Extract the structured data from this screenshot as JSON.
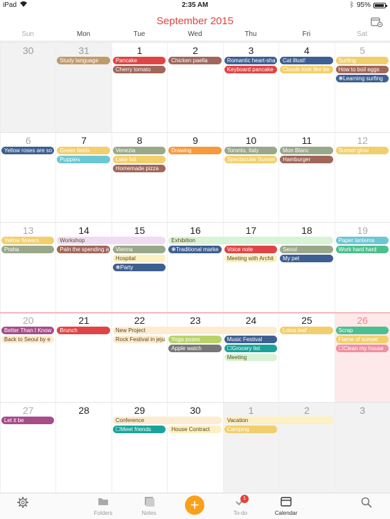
{
  "status": {
    "device": "iPad",
    "time": "2:35 AM",
    "battery": "95%",
    "battery_level": 0.95
  },
  "header": {
    "title": "September 2015"
  },
  "weekdays": [
    "Sun",
    "Mon",
    "Tue",
    "Wed",
    "Thu",
    "Fri",
    "Sat"
  ],
  "weeks": [
    {
      "days": [
        "30",
        "31",
        "1",
        "2",
        "3",
        "4",
        "5"
      ]
    },
    {
      "days": [
        "6",
        "7",
        "8",
        "9",
        "10",
        "11",
        "12"
      ]
    },
    {
      "days": [
        "13",
        "14",
        "15",
        "16",
        "17",
        "18",
        "19"
      ]
    },
    {
      "days": [
        "20",
        "21",
        "22",
        "23",
        "24",
        "25",
        "26"
      ]
    },
    {
      "days": [
        "27",
        "28",
        "29",
        "30",
        "1",
        "2",
        "3"
      ]
    }
  ],
  "events": [
    {
      "week": 0,
      "col": 1,
      "span": 1,
      "lane": 0,
      "label": "Study language",
      "color": "#c19a6b"
    },
    {
      "week": 0,
      "col": 2,
      "span": 1,
      "lane": 0,
      "label": "Pancake",
      "color": "#e04545"
    },
    {
      "week": 0,
      "col": 2,
      "span": 1,
      "lane": 1,
      "label": "Cherry tomato",
      "color": "#a0675a"
    },
    {
      "week": 0,
      "col": 3,
      "span": 1,
      "lane": 0,
      "label": "Chicken paella",
      "color": "#a0675a"
    },
    {
      "week": 0,
      "col": 4,
      "span": 1,
      "lane": 0,
      "label": "Romantic heart-sha",
      "color": "#3e5f91"
    },
    {
      "week": 0,
      "col": 4,
      "span": 1,
      "lane": 1,
      "label": "Keyboard pancake",
      "color": "#e04545"
    },
    {
      "week": 0,
      "col": 5,
      "span": 1,
      "lane": 0,
      "label": "Cat illust!",
      "color": "#3e5f91"
    },
    {
      "week": 0,
      "col": 5,
      "span": 1,
      "lane": 1,
      "label": "Clouds look like be",
      "color": "#f2cf6c"
    },
    {
      "week": 0,
      "col": 6,
      "span": 1,
      "lane": 0,
      "label": "Surfing",
      "color": "#f2cf6c"
    },
    {
      "week": 0,
      "col": 6,
      "span": 1,
      "lane": 1,
      "label": "How to boil eggs",
      "color": "#a0675a"
    },
    {
      "week": 0,
      "col": 6,
      "span": 1,
      "lane": 2,
      "label": "Learning surfing",
      "color": "#3e5f91",
      "prefix": "❋"
    },
    {
      "week": 1,
      "col": 0,
      "span": 1,
      "lane": 0,
      "label": "Yellow roses are so",
      "color": "#3e5f91"
    },
    {
      "week": 1,
      "col": 1,
      "span": 1,
      "lane": 0,
      "label": "Green fields",
      "color": "#f2cf6c"
    },
    {
      "week": 1,
      "col": 1,
      "span": 1,
      "lane": 1,
      "label": "Puppies",
      "color": "#6cc7d4"
    },
    {
      "week": 1,
      "col": 2,
      "span": 1,
      "lane": 0,
      "label": "Venezia",
      "color": "#9aa88a"
    },
    {
      "week": 1,
      "col": 2,
      "span": 1,
      "lane": 1,
      "label": "Lake fall",
      "color": "#f2cf6c"
    },
    {
      "week": 1,
      "col": 2,
      "span": 1,
      "lane": 2,
      "label": "Homemade pizza",
      "color": "#a0675a"
    },
    {
      "week": 1,
      "col": 3,
      "span": 1,
      "lane": 0,
      "label": "Drawing",
      "color": "#f59a3d"
    },
    {
      "week": 1,
      "col": 4,
      "span": 1,
      "lane": 0,
      "label": "Toronto, Italy",
      "color": "#9aa88a"
    },
    {
      "week": 1,
      "col": 4,
      "span": 1,
      "lane": 1,
      "label": "Spectacular Sunset",
      "color": "#f2cf6c"
    },
    {
      "week": 1,
      "col": 5,
      "span": 1,
      "lane": 0,
      "label": "Mon Blanc",
      "color": "#9aa88a"
    },
    {
      "week": 1,
      "col": 5,
      "span": 1,
      "lane": 1,
      "label": "Hamburger",
      "color": "#a0675a"
    },
    {
      "week": 1,
      "col": 6,
      "span": 1,
      "lane": 0,
      "label": "Sunset glow",
      "color": "#f2cf6c"
    },
    {
      "week": 2,
      "col": 0,
      "span": 1,
      "lane": 0,
      "label": "Yellow flowers",
      "color": "#f2cf6c"
    },
    {
      "week": 2,
      "col": 0,
      "span": 1,
      "lane": 1,
      "label": "Praha",
      "color": "#9aa88a"
    },
    {
      "week": 2,
      "col": 1,
      "span": 2,
      "lane": 0,
      "label": "Workshop",
      "color": "#efdcf3",
      "dark": true
    },
    {
      "week": 2,
      "col": 1,
      "span": 1,
      "lane": 1,
      "label": "Paln the spending a",
      "color": "#a0675a"
    },
    {
      "week": 2,
      "col": 2,
      "span": 1,
      "lane": 1,
      "label": "Vienna",
      "color": "#9aa88a"
    },
    {
      "week": 2,
      "col": 2,
      "span": 1,
      "lane": 2,
      "label": "Hospital",
      "color": "#fdf0c2",
      "dark": true
    },
    {
      "week": 2,
      "col": 2,
      "span": 1,
      "lane": 3,
      "label": "Party",
      "color": "#3e5f91",
      "prefix": "❋"
    },
    {
      "week": 2,
      "col": 3,
      "span": 3,
      "lane": 0,
      "label": "Exhibition",
      "color": "#d9f3d6",
      "dark": true
    },
    {
      "week": 2,
      "col": 3,
      "span": 1,
      "lane": 1,
      "label": "Traditional marke",
      "color": "#3e5f91",
      "prefix": "❋"
    },
    {
      "week": 2,
      "col": 4,
      "span": 1,
      "lane": 1,
      "label": "Voice note",
      "color": "#e04545"
    },
    {
      "week": 2,
      "col": 4,
      "span": 1,
      "lane": 2,
      "label": "Meeting with Archit",
      "color": "#fdf0c2",
      "dark": true
    },
    {
      "week": 2,
      "col": 5,
      "span": 1,
      "lane": 1,
      "label": "Seoul",
      "color": "#9aa88a"
    },
    {
      "week": 2,
      "col": 5,
      "span": 1,
      "lane": 2,
      "label": "My pet",
      "color": "#3e5f91"
    },
    {
      "week": 2,
      "col": 6,
      "span": 1,
      "lane": 0,
      "label": "Paper lanterns",
      "color": "#6cc7d4"
    },
    {
      "week": 2,
      "col": 6,
      "span": 1,
      "lane": 1,
      "label": "Work hard hard",
      "color": "#4cbf8f"
    },
    {
      "week": 3,
      "col": 0,
      "span": 1,
      "lane": 0,
      "label": "Better Than I Know",
      "color": "#a64d8a"
    },
    {
      "week": 3,
      "col": 0,
      "span": 1,
      "lane": 1,
      "label": "Back to Seoul by e",
      "color": "#fdebd2",
      "dark": true
    },
    {
      "week": 3,
      "col": 1,
      "span": 1,
      "lane": 0,
      "label": "Brunch",
      "color": "#e04545"
    },
    {
      "week": 3,
      "col": 2,
      "span": 3,
      "lane": 0,
      "label": "New Project",
      "color": "#fdebd2",
      "dark": true
    },
    {
      "week": 3,
      "col": 2,
      "span": 1,
      "lane": 1,
      "label": "Rock Festival in jeju",
      "color": "#fdebd2",
      "dark": true
    },
    {
      "week": 3,
      "col": 3,
      "span": 1,
      "lane": 1,
      "label": "Yoga poses",
      "color": "#b9d36a"
    },
    {
      "week": 3,
      "col": 3,
      "span": 1,
      "lane": 2,
      "label": "Apple watch",
      "color": "#777777"
    },
    {
      "week": 3,
      "col": 4,
      "span": 1,
      "lane": 1,
      "label": "Music Festival",
      "color": "#3e5f91"
    },
    {
      "week": 3,
      "col": 4,
      "span": 1,
      "lane": 2,
      "label": "Grocery list",
      "color": "#1aa39a",
      "prefix": "☐"
    },
    {
      "week": 3,
      "col": 4,
      "span": 1,
      "lane": 3,
      "label": "Meeting",
      "color": "#d9f3d6",
      "dark": true
    },
    {
      "week": 3,
      "col": 5,
      "span": 1,
      "lane": 0,
      "label": "Lotus leaf",
      "color": "#f2cf6c"
    },
    {
      "week": 3,
      "col": 6,
      "span": 1,
      "lane": 0,
      "label": "Scrap",
      "color": "#4cbf8f"
    },
    {
      "week": 3,
      "col": 6,
      "span": 1,
      "lane": 1,
      "label": "Flame of sunset",
      "color": "#f2cf6c"
    },
    {
      "week": 3,
      "col": 6,
      "span": 1,
      "lane": 2,
      "label": "Clean my house",
      "color": "#f08fa0",
      "prefix": "☐"
    },
    {
      "week": 4,
      "col": 0,
      "span": 1,
      "lane": 0,
      "label": "Let it be",
      "color": "#a64d8a"
    },
    {
      "week": 4,
      "col": 2,
      "span": 2,
      "lane": 0,
      "label": "Conference",
      "color": "#fdebd2",
      "dark": true
    },
    {
      "week": 4,
      "col": 2,
      "span": 1,
      "lane": 1,
      "label": "Meet friends",
      "color": "#1aa39a",
      "prefix": "☐"
    },
    {
      "week": 4,
      "col": 3,
      "span": 1,
      "lane": 1,
      "label": "House Contract",
      "color": "#fdf0c2",
      "dark": true
    },
    {
      "week": 4,
      "col": 4,
      "span": 2,
      "lane": 0,
      "label": "Vacation",
      "color": "#fdf0c2",
      "dark": true
    },
    {
      "week": 4,
      "col": 4,
      "span": 1,
      "lane": 1,
      "label": "Camping",
      "color": "#f2cf6c"
    }
  ],
  "tabbar": {
    "folders": "Folders",
    "notes": "Notes",
    "add": "+",
    "todo": "To-do",
    "todo_badge": "1",
    "calendar": "Calendar"
  }
}
